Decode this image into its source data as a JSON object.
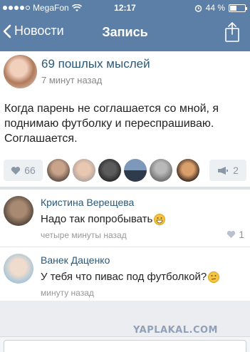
{
  "status": {
    "carrier": "MegaFon",
    "time": "12:17",
    "battery_percent": "44 %",
    "battery_level": 0.44
  },
  "nav": {
    "back_label": "Новости",
    "title": "Запись"
  },
  "post": {
    "author": "69 пошлых мыслей",
    "time": "7 минут назад",
    "text": "Когда парень не соглашается со мной, я поднимаю футболку и переспрашиваю. Соглашается.",
    "likes": "66",
    "shares": "2"
  },
  "comments": [
    {
      "name": "Кристина Верещева",
      "text": "Надо так попробывать",
      "emoji": "grin-emoji",
      "time": "четыре минуты назад",
      "likes": "1"
    },
    {
      "name": "Ванек Даценко",
      "text": "У тебя что пивас под футболкой?",
      "emoji": "confused-emoji",
      "time": "минуту назад"
    }
  ],
  "watermark": "YAPLAKAL.COM",
  "colors": {
    "header": "#5b7fa6",
    "link": "#2b587a",
    "background": "#ebedf0"
  }
}
